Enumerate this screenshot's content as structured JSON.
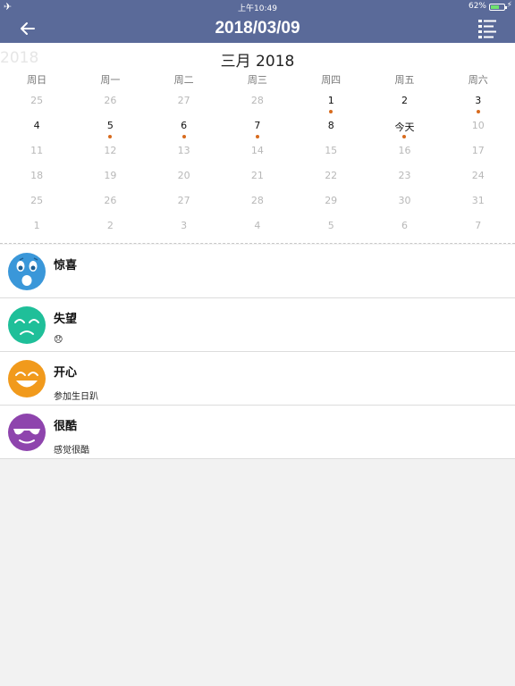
{
  "status": {
    "time": "上午10:49",
    "battery": "62%"
  },
  "header": {
    "title": "2018/03/09"
  },
  "calendar": {
    "year_ghost": "2018",
    "month_title": "三月 2018",
    "weekdays": [
      "周日",
      "周一",
      "周二",
      "周三",
      "周四",
      "周五",
      "周六"
    ],
    "weeks": [
      [
        {
          "d": "25",
          "o": true
        },
        {
          "d": "26",
          "o": true
        },
        {
          "d": "27",
          "o": true
        },
        {
          "d": "28",
          "o": true
        },
        {
          "d": "1",
          "dot": true
        },
        {
          "d": "2"
        },
        {
          "d": "3",
          "dot": true
        }
      ],
      [
        {
          "d": "4"
        },
        {
          "d": "5",
          "dot": true
        },
        {
          "d": "6",
          "dot": true
        },
        {
          "d": "7",
          "dot": true
        },
        {
          "d": "8"
        },
        {
          "d": "今天",
          "dot": true
        },
        {
          "d": "10",
          "o": true
        }
      ],
      [
        {
          "d": "11",
          "o": true
        },
        {
          "d": "12",
          "o": true
        },
        {
          "d": "13",
          "o": true
        },
        {
          "d": "14",
          "o": true
        },
        {
          "d": "15",
          "o": true
        },
        {
          "d": "16",
          "o": true
        },
        {
          "d": "17",
          "o": true
        }
      ],
      [
        {
          "d": "18",
          "o": true
        },
        {
          "d": "19",
          "o": true
        },
        {
          "d": "20",
          "o": true
        },
        {
          "d": "21",
          "o": true
        },
        {
          "d": "22",
          "o": true
        },
        {
          "d": "23",
          "o": true
        },
        {
          "d": "24",
          "o": true
        }
      ],
      [
        {
          "d": "25",
          "o": true
        },
        {
          "d": "26",
          "o": true
        },
        {
          "d": "27",
          "o": true
        },
        {
          "d": "28",
          "o": true
        },
        {
          "d": "29",
          "o": true
        },
        {
          "d": "30",
          "o": true
        },
        {
          "d": "31",
          "o": true
        }
      ],
      [
        {
          "d": "1",
          "o": true
        },
        {
          "d": "2",
          "o": true
        },
        {
          "d": "3",
          "o": true
        },
        {
          "d": "4",
          "o": true
        },
        {
          "d": "5",
          "o": true
        },
        {
          "d": "6",
          "o": true
        },
        {
          "d": "7",
          "o": true
        }
      ]
    ]
  },
  "entries": [
    {
      "mood": "惊喜",
      "note": "",
      "face": "surprised-face-icon",
      "color": "#3a97d9"
    },
    {
      "mood": "失望",
      "note": "😞",
      "face": "disappointed-face-icon",
      "color": "#1fbf99"
    },
    {
      "mood": "开心",
      "note": "参加生日趴",
      "face": "happy-face-icon",
      "color": "#f19a1c"
    },
    {
      "mood": "很酷",
      "note": "感觉很酷",
      "face": "cool-face-icon",
      "color": "#8e44ad"
    }
  ]
}
